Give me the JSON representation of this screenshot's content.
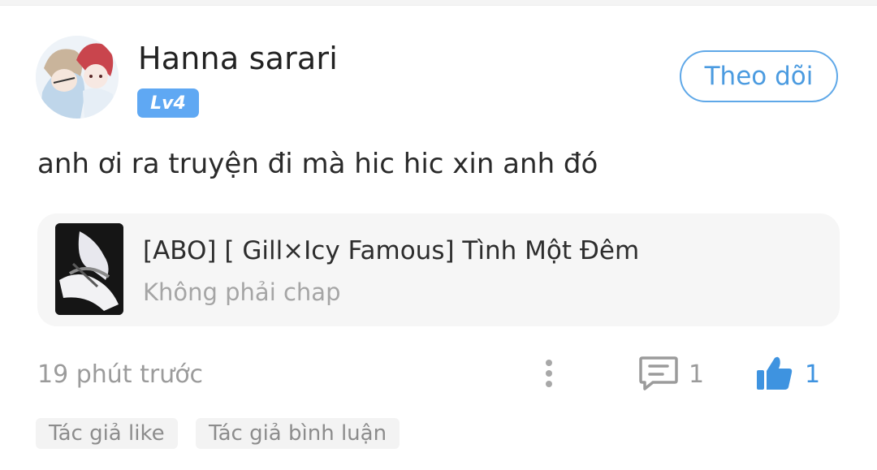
{
  "comment": {
    "username": "Hanna sarari",
    "level": "Lv4",
    "follow_label": "Theo dõi",
    "text": "anh ơi ra truyện đi mà hic hic xin anh đó",
    "story": {
      "title": "[ABO] [ Gill×Icy Famous] Tình Một Đêm",
      "subtitle": "Không phải chap"
    },
    "timestamp": "19 phút trước",
    "reply_count": "1",
    "like_count": "1",
    "tags": [
      "Tác giả like",
      "Tác giả bình luận"
    ]
  },
  "colors": {
    "accent": "#4b9be0",
    "badge": "#5fa8f3",
    "muted": "#9b9b9b",
    "card_bg": "#f6f6f6"
  },
  "icons": {
    "more": "more-vertical-icon",
    "reply": "comment-bubble-icon",
    "like": "thumbs-up-icon"
  }
}
